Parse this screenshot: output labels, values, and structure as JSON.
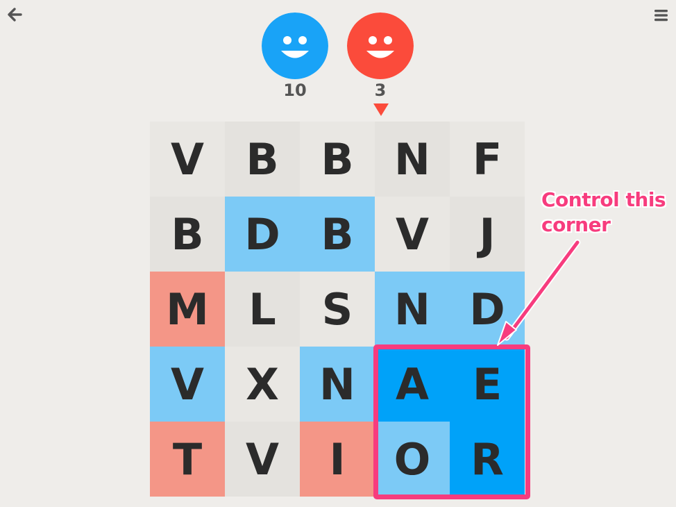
{
  "nav": {
    "back_icon": "arrow-left-icon",
    "menu_icon": "hamburger-menu-icon"
  },
  "players": [
    {
      "name_icon": "smiley-face-icon",
      "color": "#19a3f7",
      "score": "10"
    },
    {
      "name_icon": "smiley-face-icon",
      "color": "#fb4b3b",
      "score": "3"
    }
  ],
  "turn_indicator": {
    "icon": "triangle-down-icon",
    "color": "#fb4b3b",
    "player": 2
  },
  "board": {
    "rows": 5,
    "cols": 5,
    "tiles": [
      {
        "letter": "V",
        "owner": "neutral"
      },
      {
        "letter": "B",
        "owner": "neutral"
      },
      {
        "letter": "B",
        "owner": "neutral"
      },
      {
        "letter": "N",
        "owner": "neutral"
      },
      {
        "letter": "F",
        "owner": "neutral"
      },
      {
        "letter": "B",
        "owner": "neutral"
      },
      {
        "letter": "D",
        "owner": "blue"
      },
      {
        "letter": "B",
        "owner": "blue"
      },
      {
        "letter": "V",
        "owner": "neutral"
      },
      {
        "letter": "J",
        "owner": "neutral"
      },
      {
        "letter": "M",
        "owner": "red"
      },
      {
        "letter": "L",
        "owner": "neutral"
      },
      {
        "letter": "S",
        "owner": "neutral"
      },
      {
        "letter": "N",
        "owner": "blue"
      },
      {
        "letter": "D",
        "owner": "blue"
      },
      {
        "letter": "V",
        "owner": "blue"
      },
      {
        "letter": "X",
        "owner": "neutral"
      },
      {
        "letter": "N",
        "owner": "blue"
      },
      {
        "letter": "A",
        "owner": "blue-locked"
      },
      {
        "letter": "E",
        "owner": "blue-locked"
      },
      {
        "letter": "T",
        "owner": "red"
      },
      {
        "letter": "V",
        "owner": "neutral"
      },
      {
        "letter": "I",
        "owner": "red"
      },
      {
        "letter": "O",
        "owner": "blue"
      },
      {
        "letter": "R",
        "owner": "blue-locked"
      }
    ]
  },
  "annotation": {
    "line1": "Control this",
    "line2": "corner",
    "color": "#f73c7e"
  }
}
